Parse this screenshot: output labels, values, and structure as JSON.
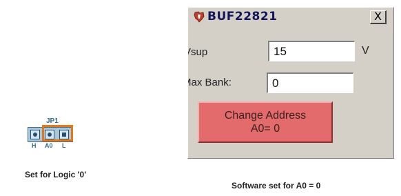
{
  "jumper": {
    "label": "JP1",
    "pin_labels": [
      "H",
      "A0",
      "L"
    ],
    "caption": "Set for Logic '0'",
    "highlight_color": "#e77817"
  },
  "dialog": {
    "title": "BUF22821",
    "icon": "ti-logo-icon",
    "close_label": "X",
    "vsup_label": "Vsup",
    "vsup_value": "15",
    "vsup_unit": "V",
    "max_bank_label": "Max Bank:",
    "max_bank_value": "0",
    "change_button_line1": "Change Address",
    "change_button_line2": "A0= 0",
    "button_color": "#e36b6b"
  },
  "caption_right": "Software set for A0 = 0"
}
